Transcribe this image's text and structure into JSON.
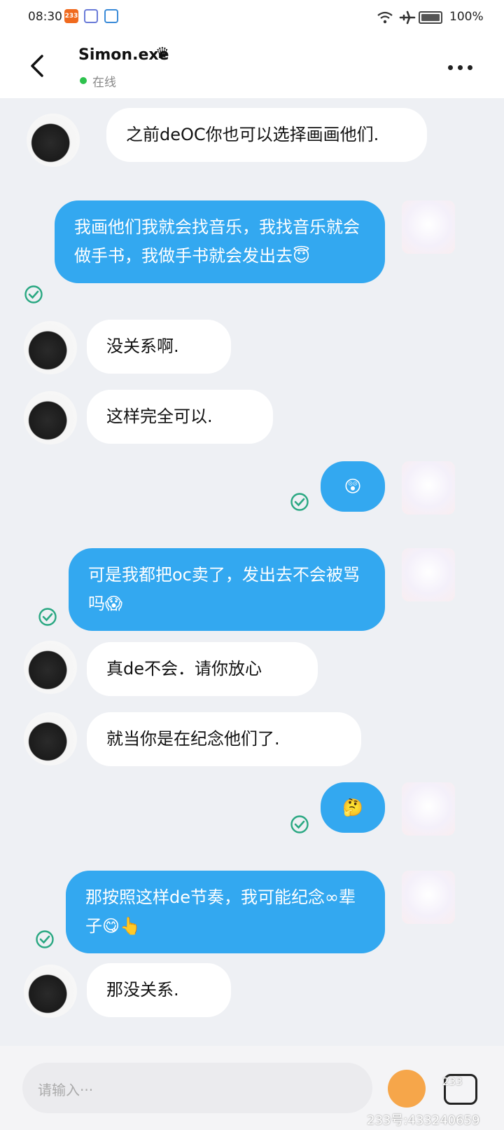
{
  "status_bar": {
    "time": "08:30",
    "app_icon_label": "233",
    "battery": "100%",
    "icons": [
      "wifi-icon",
      "airplane-icon",
      "battery-icon"
    ]
  },
  "header": {
    "name": "Simon.exe",
    "crown": "♛",
    "status": "在线",
    "online_color": "#2dc24d"
  },
  "messages": [
    {
      "side": "in",
      "text": "之前deOC你也可以选择画画他们."
    },
    {
      "side": "out",
      "text": "我画他们我就会找音乐，我找音乐就会做手书，我做手书就会发出去😇",
      "read": true
    },
    {
      "side": "in",
      "text": "没关系啊."
    },
    {
      "side": "in",
      "text": "这样完全可以."
    },
    {
      "side": "out",
      "text": "😲",
      "read": true
    },
    {
      "side": "out",
      "text": "可是我都把oc卖了，发出去不会被骂吗😱",
      "read": true
    },
    {
      "side": "in",
      "text": "真de不会．请你放心"
    },
    {
      "side": "in",
      "text": "就当你是在纪念他们了."
    },
    {
      "side": "out",
      "text": "🤔",
      "read": true
    },
    {
      "side": "out",
      "text": "那按照这样de节奏，我可能纪念∞辈子😋👆",
      "read": true
    },
    {
      "side": "in",
      "text": "那没关系."
    }
  ],
  "input": {
    "placeholder": "请输入···"
  },
  "watermark": {
    "text": "233号:433240659",
    "tag": "233"
  },
  "colors": {
    "outgoing_bubble": "#33a8f0",
    "incoming_bubble": "#ffffff",
    "background": "#eef0f4"
  }
}
